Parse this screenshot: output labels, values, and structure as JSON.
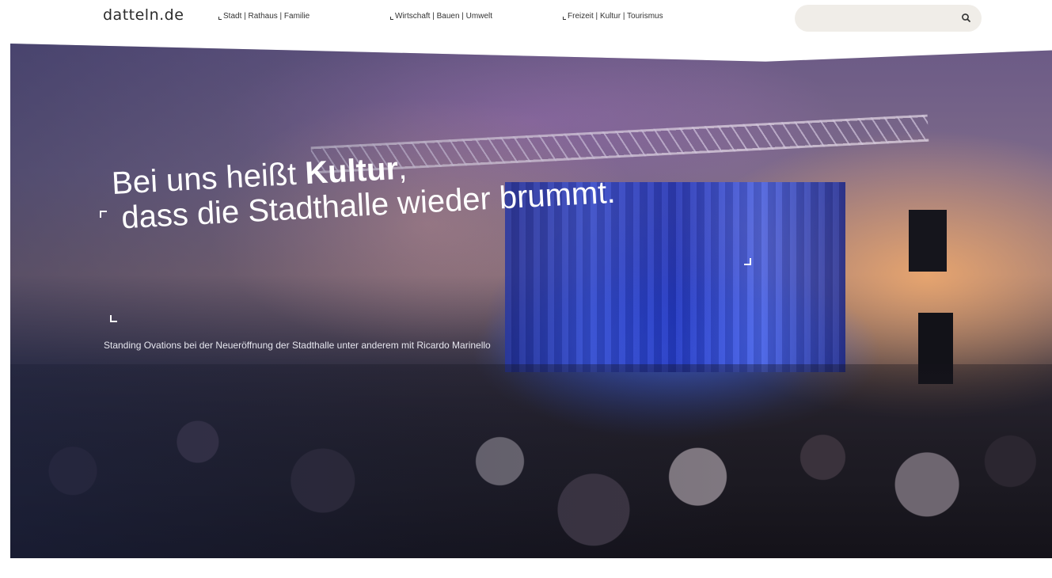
{
  "header": {
    "logo": "datteln.de",
    "nav": [
      {
        "label": "Stadt | Rathaus | Familie"
      },
      {
        "label": "Wirtschaft | Bauen | Umwelt"
      },
      {
        "label": "Freizeit | Kultur | Tourismus"
      }
    ],
    "search": {
      "placeholder": "",
      "icon": "search-icon"
    }
  },
  "hero": {
    "headline_pre": "Bei uns heißt ",
    "headline_bold": "Kultur",
    "headline_post": ",",
    "headline_line2": "dass die Stadthalle wieder brummt.",
    "caption": "Standing Ovations bei der Neueröffnung der Stadthalle unter anderem mit Ricardo Marinello"
  },
  "colors": {
    "search_bg": "#f0ede8",
    "text_dark": "#333333",
    "hero_text": "#ffffff"
  }
}
